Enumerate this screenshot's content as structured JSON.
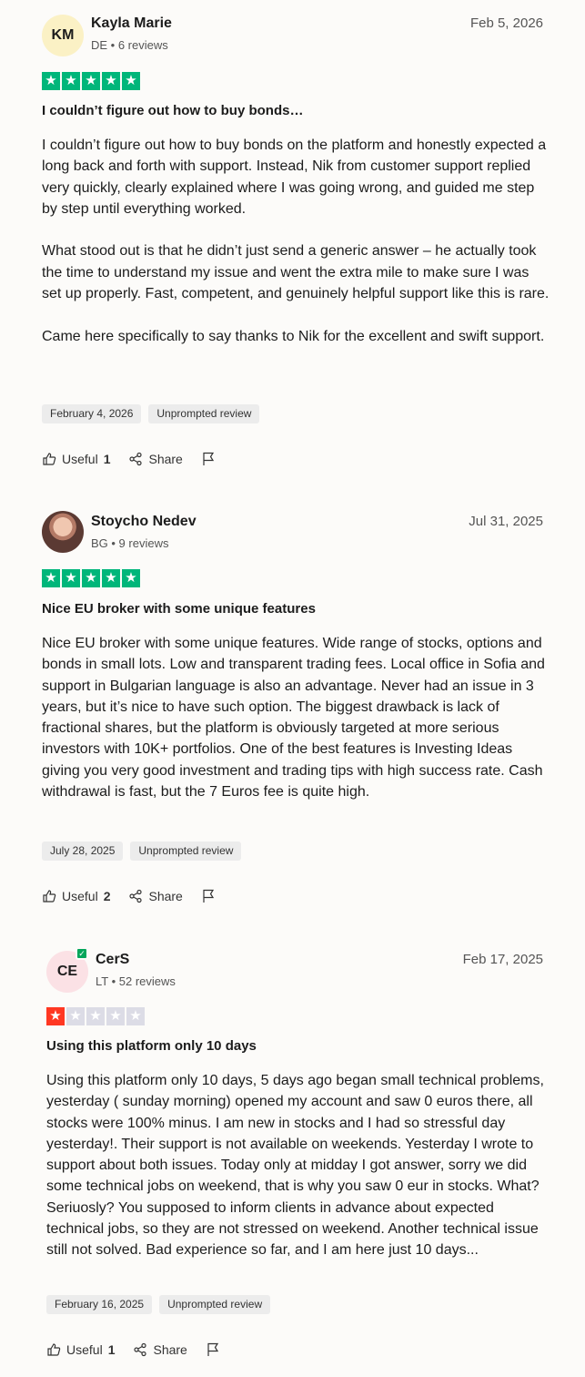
{
  "reviews": [
    {
      "initials": "KM",
      "name": "Kayla Marie",
      "meta": "DE • 6 reviews",
      "date": "Feb 5, 2026",
      "rating": 5,
      "title": "I couldn’t figure out how to buy bonds…",
      "paragraphs": [
        "I couldn’t figure out how to buy bonds on the platform and honestly expected a long back and forth with support. Instead, Nik from customer support replied very quickly, clearly explained where I was going wrong, and guided me step by step until everything worked.",
        "What stood out is that he didn’t just send a generic answer – he actually took the time to understand my issue and went the extra mile to make sure I was set up properly. Fast, competent, and genuinely helpful support like this is rare.",
        "Came here specifically to say thanks to Nik for the excellent and swift support."
      ],
      "experience_date": "February 4, 2026",
      "tag": "Unprompted review",
      "useful_label": "Useful",
      "useful_count": "1",
      "share_label": "Share"
    },
    {
      "initials": "",
      "name": "Stoycho Nedev",
      "meta": "BG • 9 reviews",
      "date": "Jul 31, 2025",
      "rating": 5,
      "title": "Nice EU broker with some unique features",
      "paragraphs": [
        "Nice EU broker with some unique features. Wide range of stocks, options and bonds in small lots. Low and transparent trading fees. Local office in Sofia and support in Bulgarian language is also an advantage. Never had an issue in 3 years, but it’s nice to have such option. The biggest drawback is lack of fractional shares, but the platform is obviously targeted at more serious investors with 10K+ portfolios. One of the best features is Investing Ideas giving you very good investment and trading tips with high success rate. Cash withdrawal is fast, but the 7 Euros fee is quite high."
      ],
      "experience_date": "July 28, 2025",
      "tag": "Unprompted review",
      "useful_label": "Useful",
      "useful_count": "2",
      "share_label": "Share"
    },
    {
      "initials": "CE",
      "name": "CerS",
      "meta": "LT • 52 reviews",
      "date": "Feb 17, 2025",
      "rating": 1,
      "title": "Using this platform only 10 days",
      "paragraphs": [
        "Using this platform only 10 days, 5 days ago began small technical problems, yesterday ( sunday morning) opened my account and saw 0 euros there, all stocks were 100% minus. I am new in stocks and I had so stressful day yesterday!. Their support is not available on weekends. Yesterday I wrote to support about both issues. Today only at midday I got answer, sorry we did some technical jobs on weekend, that is why you saw 0 eur in stocks. What? Seriuosly? You supposed to inform clients in advance about expected technical jobs, so they are not stressed on weekend. Another technical issue still not solved. Bad experience so far, and I am here just 10 days..."
      ],
      "experience_date": "February 16, 2025",
      "tag": "Unprompted review",
      "useful_label": "Useful",
      "useful_count": "1",
      "share_label": "Share"
    }
  ],
  "colors": {
    "star_green": "#00b67a",
    "star_red": "#ff3722",
    "star_empty": "#dcdce6",
    "verified_badge": "#04a65b"
  }
}
